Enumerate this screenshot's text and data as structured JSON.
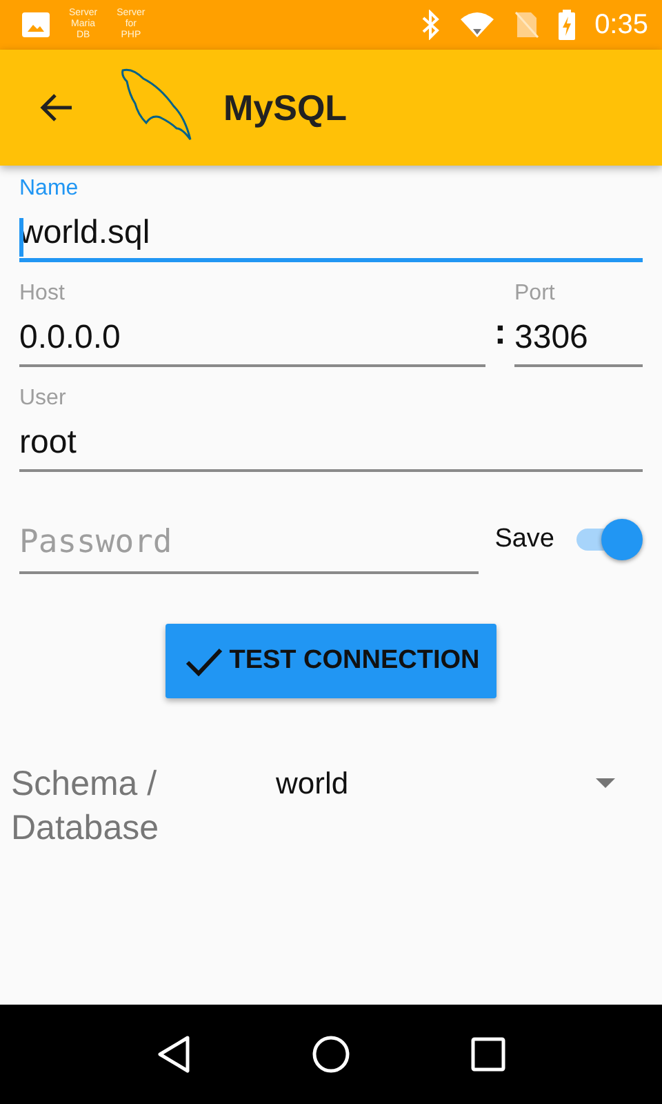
{
  "status_bar": {
    "notifications": [
      {
        "kind": "picture"
      },
      {
        "kind": "label",
        "lines": [
          "Server",
          "Maria",
          "DB"
        ]
      },
      {
        "kind": "label",
        "lines": [
          "Server",
          "for",
          "PHP"
        ]
      }
    ],
    "time": "0:35"
  },
  "app_bar": {
    "title": "MySQL"
  },
  "form": {
    "name": {
      "label": "Name",
      "value": "world.sql",
      "focused": true
    },
    "host": {
      "label": "Host",
      "value": "0.0.0.0"
    },
    "separator": ":",
    "port": {
      "label": "Port",
      "value": "3306"
    },
    "user": {
      "label": "User",
      "value": "root"
    },
    "password": {
      "placeholder": "Password"
    },
    "save": {
      "label": "Save",
      "on": true
    },
    "test_button": "TEST CONNECTION",
    "schema": {
      "label": "Schema / Database",
      "value": "world"
    }
  }
}
